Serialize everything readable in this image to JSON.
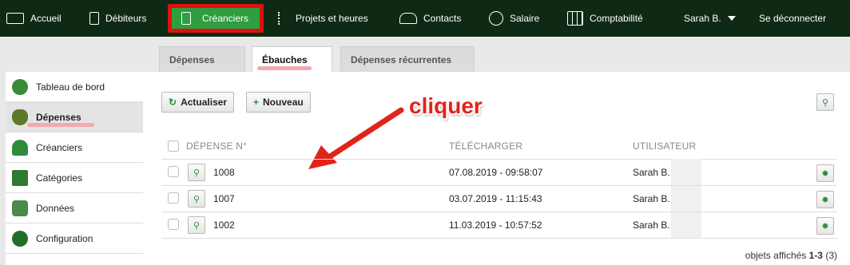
{
  "nav": {
    "items": [
      {
        "label": "Accueil",
        "icon": "keyboard-icon"
      },
      {
        "label": "Débiteurs",
        "icon": "document-icon"
      },
      {
        "label": "Créanciers",
        "icon": "document-icon"
      },
      {
        "label": "Projets et heures",
        "icon": "checklist-icon"
      },
      {
        "label": "Contacts",
        "icon": "people-icon"
      },
      {
        "label": "Salaire",
        "icon": "money-clock-icon"
      },
      {
        "label": "Comptabilité",
        "icon": "grid-icon"
      }
    ],
    "user": "Sarah B.",
    "logout": "Se déconnecter"
  },
  "tabs": [
    "Dépenses",
    "Ébauches",
    "Dépenses récurrentes"
  ],
  "sidebar": {
    "items": [
      {
        "label": "Tableau de bord",
        "icon": "globe-icon"
      },
      {
        "label": "Dépenses",
        "icon": "money-bag-icon"
      },
      {
        "label": "Créanciers",
        "icon": "person-icon"
      },
      {
        "label": "Catégories",
        "icon": "book-icon"
      },
      {
        "label": "Données",
        "icon": "database-gear-icon"
      },
      {
        "label": "Configuration",
        "icon": "clock-icon"
      }
    ]
  },
  "toolbar": {
    "refresh": "Actualiser",
    "new": "Nouveau"
  },
  "annotation": "cliquer",
  "table": {
    "headers": [
      "DÉPENSE N°",
      "TÉLÉCHARGER",
      "UTILISATEUR"
    ],
    "rows": [
      {
        "number": "1008",
        "date": "07.08.2019 - 09:58:07",
        "user": "Sarah B."
      },
      {
        "number": "1007",
        "date": "03.07.2019 - 11:15:43",
        "user": "Sarah B."
      },
      {
        "number": "1002",
        "date": "11.03.2019 - 10:57:52",
        "user": "Sarah B."
      }
    ]
  },
  "footer": {
    "prefix": "objets affichés",
    "range": "1-3",
    "total": "(3)"
  },
  "colors": {
    "nav_bg": "#0f2a14",
    "active_green": "#2e9e40",
    "highlight_red": "#e01010",
    "annotation_red": "#e2231a"
  }
}
